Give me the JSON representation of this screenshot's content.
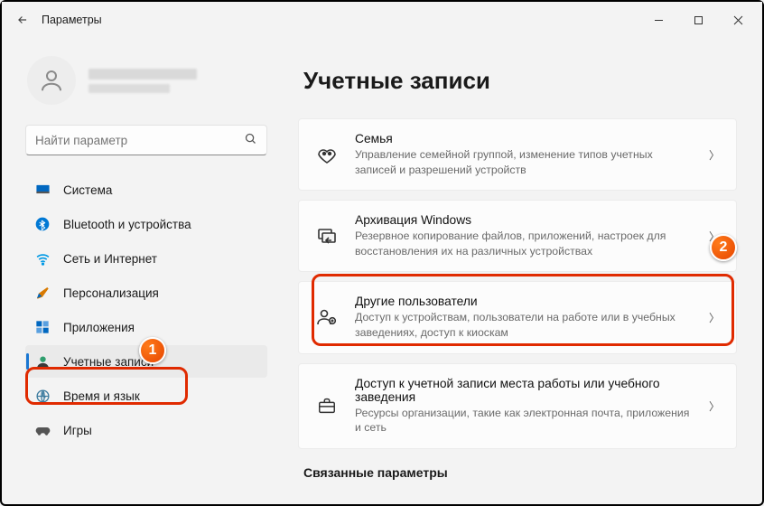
{
  "window": {
    "title": "Параметры"
  },
  "search": {
    "placeholder": "Найти параметр"
  },
  "sidebar": {
    "items": [
      {
        "label": "Система"
      },
      {
        "label": "Bluetooth и устройства"
      },
      {
        "label": "Сеть и Интернет"
      },
      {
        "label": "Персонализация"
      },
      {
        "label": "Приложения"
      },
      {
        "label": "Учетные записи"
      },
      {
        "label": "Время и язык"
      },
      {
        "label": "Игры"
      }
    ],
    "active_index": 5
  },
  "page": {
    "heading": "Учетные записи",
    "cards": [
      {
        "title": "Семья",
        "desc": "Управление семейной группой, изменение типов учетных записей и разрешений устройств"
      },
      {
        "title": "Архивация Windows",
        "desc": "Резервное копирование файлов, приложений, настроек для восстановления их на различных устройствах"
      },
      {
        "title": "Другие пользователи",
        "desc": "Доступ к устройствам, пользователи на работе или в учебных заведениях, доступ к киоскам"
      },
      {
        "title": "Доступ к учетной записи места работы или учебного заведения",
        "desc": "Ресурсы организации, такие как электронная почта, приложения и сеть"
      }
    ],
    "section2": "Связанные параметры"
  },
  "annotations": {
    "badge1": "1",
    "badge2": "2"
  }
}
